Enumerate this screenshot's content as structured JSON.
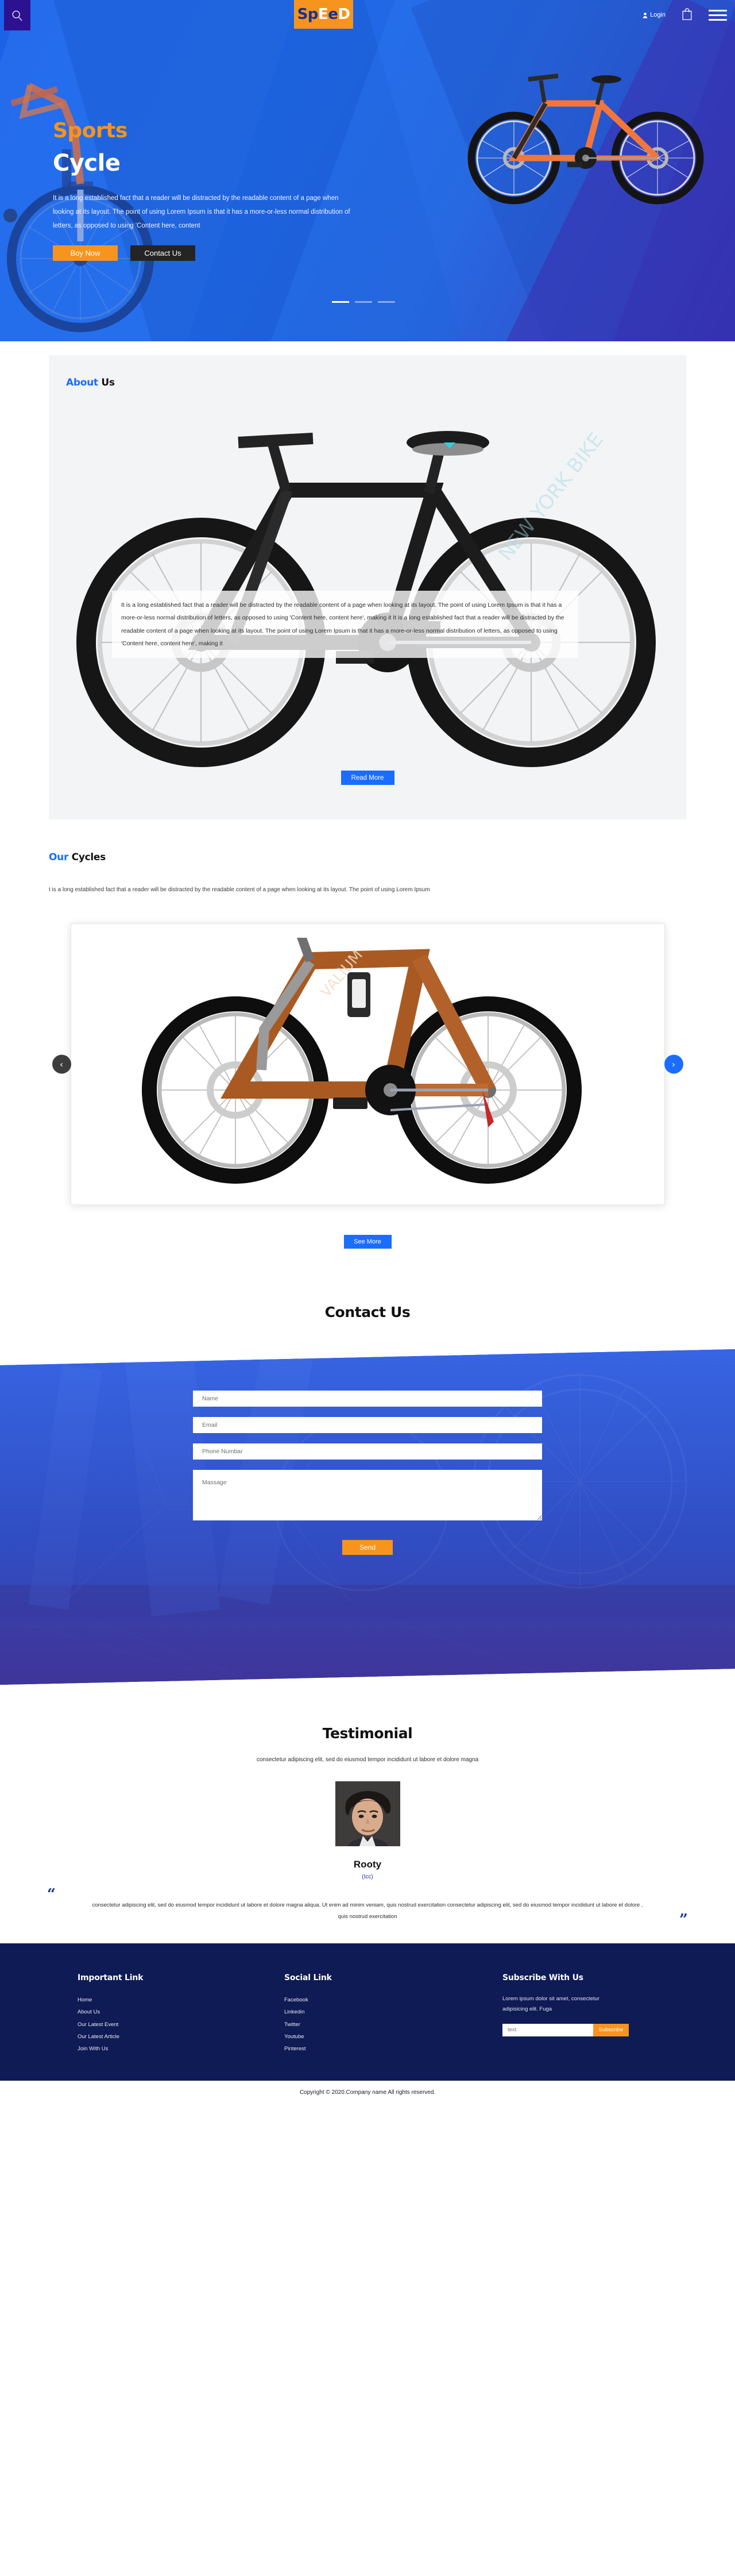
{
  "header": {
    "search_icon": "search-icon",
    "logo": {
      "part_a": "Sp",
      "part_b": "E",
      "part_c": "e",
      "part_d": "D",
      "full": "SpEeD"
    },
    "login_label": "Login",
    "cart_icon": "shopping-bag-icon",
    "menu_icon": "hamburger-menu-icon",
    "accent_orange": "#f7941e",
    "accent_blue": "#1a6dff",
    "search_bg": "#2c1191"
  },
  "hero": {
    "kicker": "Sports",
    "title": "Cycle",
    "description": "It is a long established fact that a reader will be distracted by the readable content of a page when looking at its layout. The point of using Lorem Ipsum is that it has a more-or-less normal distribution of letters, as opposed to using 'Content here, content",
    "buy_label": "Boy Now",
    "contact_label": "Contact Us",
    "slides": 3,
    "active_slide": 1
  },
  "about": {
    "title_highlight": "About",
    "title_rest": "Us",
    "text": "It is a long established fact that a reader will be distracted by the readable content of a page when looking at its layout. The point of using Lorem Ipsum is that it has a more-or-less normal distribution of letters, as opposed to using 'Content here, content here', making it It is a long established fact that a reader will be distracted by the readable content of a page when looking at its layout. The point of using Lorem Ipsum is that it has a more-or-less normal distribution of letters, as opposed to using 'Content here, content here', making it",
    "read_more_label": "Read More"
  },
  "cycles": {
    "title_highlight": "Our",
    "title_rest": "Cycles",
    "description": "t is a long established fact that a reader will be distracted by the readable content of a page when looking at its layout. The point of using Lorem Ipsum",
    "prev_icon": "chevron-left-icon",
    "next_icon": "chevron-right-icon",
    "prev_glyph": "‹",
    "next_glyph": "›",
    "see_more_label": "See More"
  },
  "contact": {
    "title": "Contact Us",
    "fields": {
      "name_placeholder": "Name",
      "email_placeholder": "Email",
      "phone_placeholder": "Phone Numbar",
      "message_placeholder": "Massage"
    },
    "send_label": "Send"
  },
  "testimonial": {
    "title": "Testimonial",
    "subtitle": "consectetur adipiscing elit, sed do eiusmod tempor incididunt ut labore et dolore magna",
    "avatar_alt": "avatar",
    "name": "Rooty",
    "role": "(Icc)",
    "quote_open": "“",
    "quote_close": "”",
    "quote": "consectetur adipiscing elit, sed do eiusmod tempor incididunt ut labore et dolore magna aliqua. Ut enim ad minim veniam, quis nostrud exercitation consectetur adipiscing elit, sed do eiusmod tempor incididunt ut labore et dolore , quis nostrud exercitation"
  },
  "footer": {
    "important": {
      "title": "Important Link",
      "links": [
        "Home",
        "About Us",
        "Our Latest Event",
        "Our Latest Article",
        "Join With Us"
      ]
    },
    "social": {
      "title": "Social Link",
      "links": [
        "Facebook",
        "Linkedin",
        "Twitter",
        "Youtube",
        "Pinterest"
      ]
    },
    "subscribe": {
      "title": "Subscribe With Us",
      "description": "Lorem ipsum dolor sit amet, consectetur adipisicing elit. Fuga",
      "input_placeholder": "text",
      "button_label": "Subscribe"
    },
    "bg": "#0e1b54"
  },
  "copyright": "Copyright © 2020.Company name All rights reserved."
}
